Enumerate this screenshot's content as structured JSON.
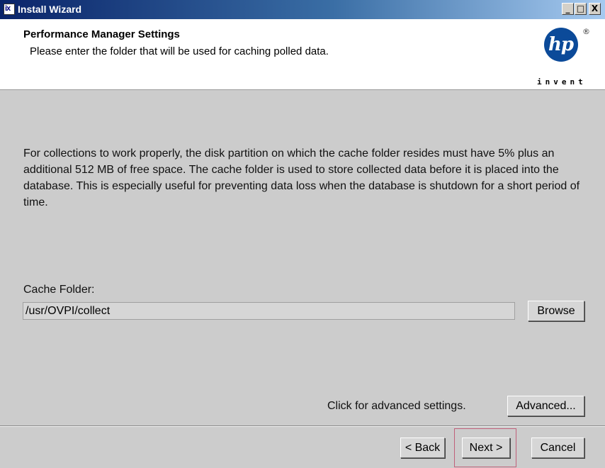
{
  "window": {
    "title": "Install Wizard",
    "app_icon_text": "ix",
    "controls": {
      "minimize": "_",
      "maximize": "□",
      "close": "X"
    }
  },
  "header": {
    "title": "Performance Manager Settings",
    "subtitle": "Please enter the folder that will be used for caching polled data.",
    "logo": {
      "text": "hp",
      "registered": "®",
      "tagline": "invent",
      "color": "#0b4a99"
    }
  },
  "main": {
    "description": "For collections to work properly, the disk partition on which the cache folder resides must have 5% plus an additional 512 MB of free space. The cache folder is used to store collected data before it is placed into the database. This is especially useful for preventing data loss when the database is shutdown for a short period of time.",
    "cache_folder": {
      "label": "Cache Folder:",
      "value": "/usr/OVPI/collect",
      "browse_label": "Browse"
    },
    "advanced": {
      "text": "Click for advanced settings.",
      "button_label": "Advanced..."
    }
  },
  "footer": {
    "back_label": "< Back",
    "next_label": "Next >",
    "cancel_label": "Cancel"
  }
}
